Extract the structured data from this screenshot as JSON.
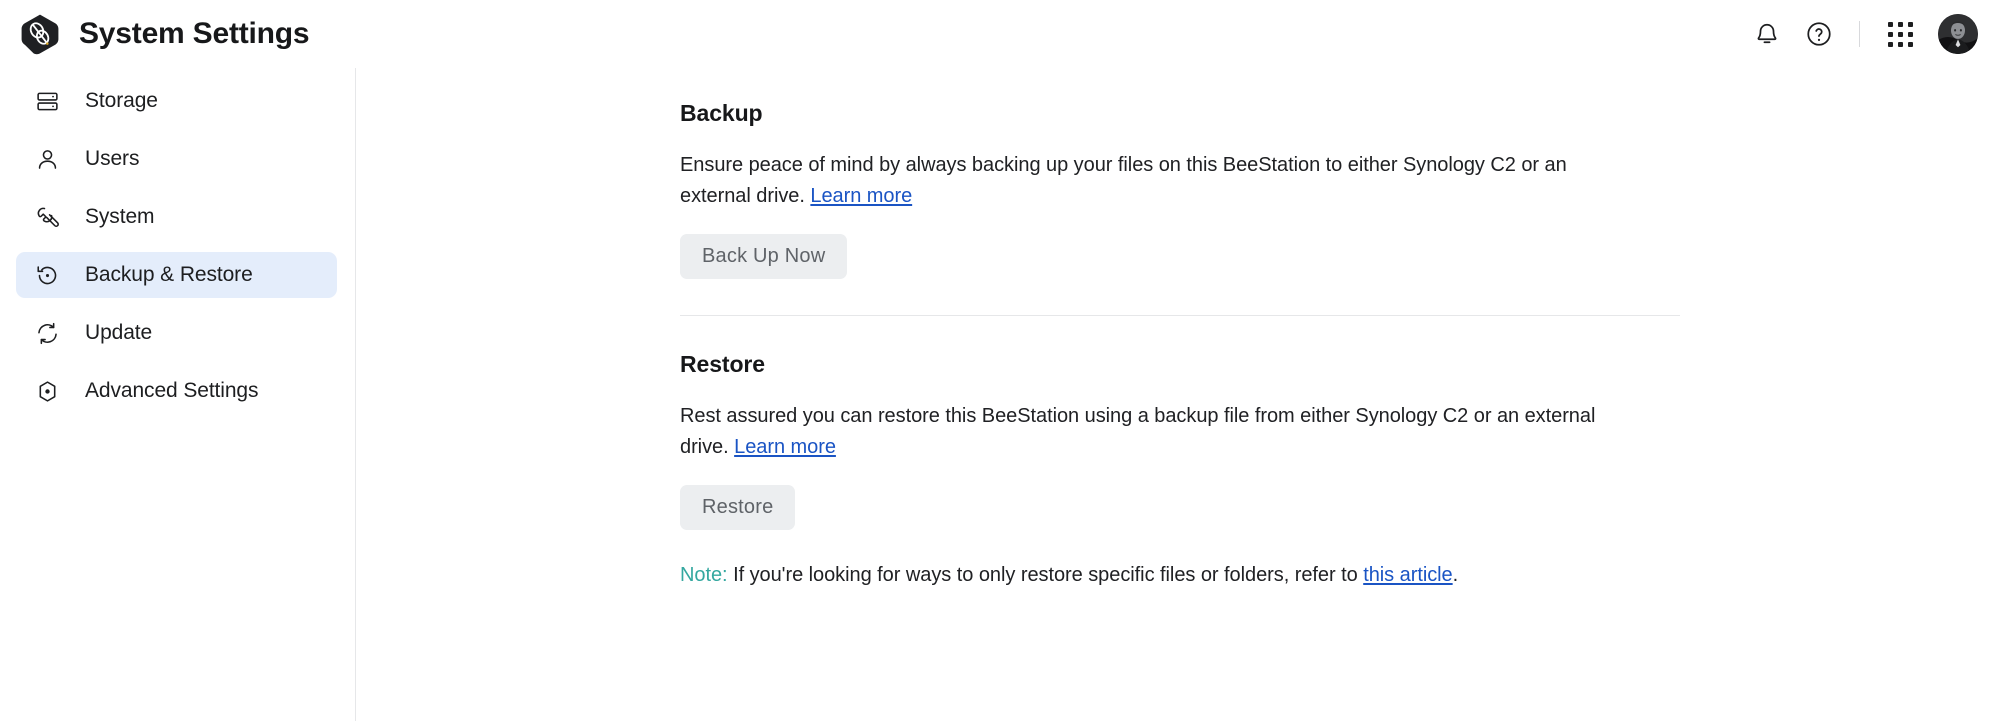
{
  "header": {
    "title": "System Settings",
    "logo_icon": "beestation-hex-logo",
    "icons": {
      "notifications": "bell-icon",
      "help": "question-circle-icon",
      "apps": "apps-grid-icon",
      "avatar": "user-avatar"
    }
  },
  "sidebar": {
    "items": [
      {
        "label": "Storage",
        "icon": "storage-icon",
        "active": false
      },
      {
        "label": "Users",
        "icon": "user-icon",
        "active": false
      },
      {
        "label": "System",
        "icon": "wrench-icon",
        "active": false
      },
      {
        "label": "Backup & Restore",
        "icon": "backup-restore-icon",
        "active": true
      },
      {
        "label": "Update",
        "icon": "refresh-icon",
        "active": false
      },
      {
        "label": "Advanced Settings",
        "icon": "hex-gear-icon",
        "active": false
      }
    ]
  },
  "main": {
    "backup": {
      "title": "Backup",
      "description_before_link": "Ensure peace of mind by always backing up your files on this BeeStation to either Synology C2 or an external drive. ",
      "link_label": "Learn more",
      "button_label": "Back Up Now"
    },
    "restore": {
      "title": "Restore",
      "description_before_link": "Rest assured you can restore this BeeStation using a backup file from either Synology C2 or an external drive. ",
      "link_label": "Learn more",
      "button_label": "Restore",
      "note_label": "Note:",
      "note_text_before_link": " If you're looking for ways to only restore specific files or folders, refer to ",
      "note_link_label": "this article",
      "note_text_after_link": "."
    }
  },
  "colors": {
    "accent_link": "#1a54c4",
    "sidebar_active_bg": "#e4edfb",
    "note_teal": "#35a8a0",
    "button_bg": "#eceef0",
    "button_text": "#5f6368"
  }
}
